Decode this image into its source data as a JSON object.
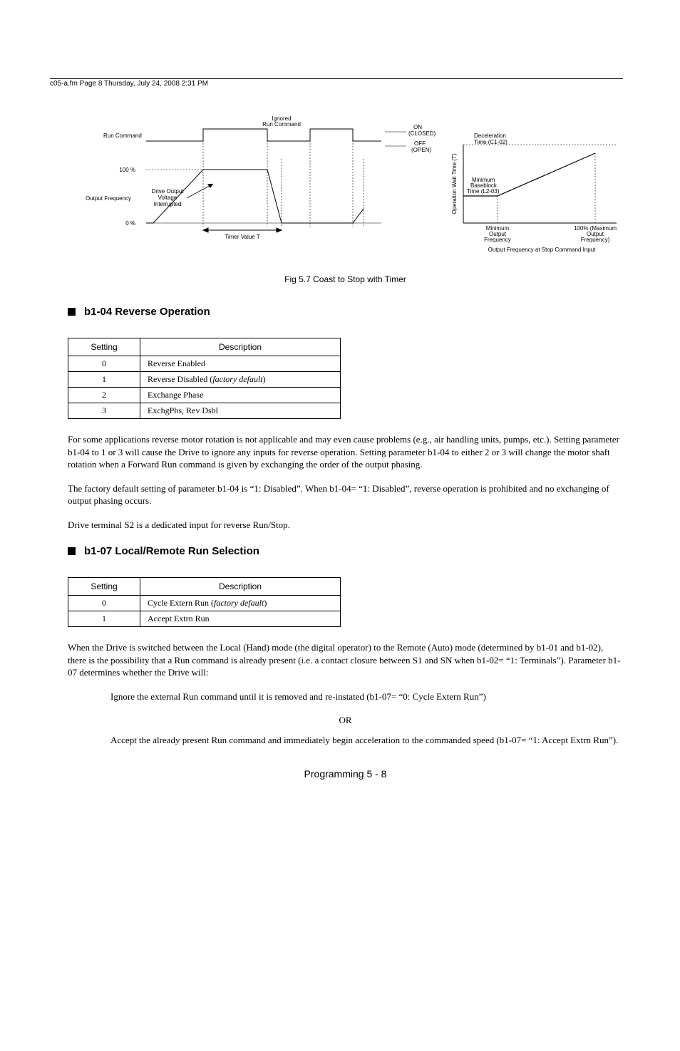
{
  "header_note": "c05-a.fm  Page 8  Thursday, July 24, 2008  2:31 PM",
  "figure": {
    "labels": {
      "ignored": "Ignored",
      "run_cmd_top": "Run Command",
      "run_command": "Run Command",
      "output_freq": "Output Frequency",
      "drive_out1": "Drive Output",
      "drive_out2": "Voltage",
      "drive_out3": "Interrupted",
      "p100": "100 %",
      "p0": "0 %",
      "timer": "Timer Value T",
      "on": "ON",
      "closed": "(CLOSED)",
      "off": "OFF",
      "open": "(OPEN)",
      "decel1": "Deceleration",
      "decel2": "Time (C1-02)",
      "yaxis": "Operation Wait Time (T)",
      "min1": "Minimum",
      "min2": "Baseblock",
      "min3": "Time (L2-03)",
      "xmin1": "Minimum",
      "xmin2": "Output",
      "xmin3": "Frequency",
      "xmax1": "100% (Maximum",
      "xmax2": "Output",
      "xmax3": "Frequency)",
      "xaxis": "Output Frequency at Stop Command Input"
    },
    "caption": "Fig 5.7  Coast to Stop with Timer"
  },
  "section1": {
    "title": "b1-04  Reverse Operation",
    "th_setting": "Setting",
    "th_desc": "Description",
    "rows": [
      {
        "s": "0",
        "d": "Reverse Enabled"
      },
      {
        "s": "1",
        "d_pre": "Reverse Disabled (",
        "d_it": "factory default",
        "d_post": ")"
      },
      {
        "s": "2",
        "d": "Exchange Phase"
      },
      {
        "s": "3",
        "d": "ExchgPhs, Rev Dsbl"
      }
    ],
    "p1": "For some applications reverse motor rotation is not applicable and may even cause problems (e.g., air handling units, pumps, etc.). Setting parameter b1-04 to 1 or 3 will cause the Drive to ignore any inputs for reverse operation. Setting parameter b1-04 to either 2 or 3 will change the motor shaft rotation when a Forward Run command is given by exchanging the order of the output phasing.",
    "p2": "The factory default setting of parameter b1-04 is “1: Disabled”. When b1-04= “1: Disabled”, reverse operation is prohibited and no exchanging of output phasing occurs.",
    "p3": "Drive terminal S2 is a dedicated input for reverse Run/Stop."
  },
  "section2": {
    "title": "b1-07  Local/Remote Run Selection",
    "th_setting": "Setting",
    "th_desc": "Description",
    "rows": [
      {
        "s": "0",
        "d_pre": "Cycle Extern Run (",
        "d_it": "factory default",
        "d_post": ")"
      },
      {
        "s": "1",
        "d": "Accept Extrn Run"
      }
    ],
    "p1": "When the Drive is switched between the Local (Hand) mode (the digital operator) to the Remote (Auto) mode (determined by b1-01 and b1-02), there is the possibility that a Run command is already present (i.e. a contact closure between S1 and SN when b1-02= “1: Terminals”). Parameter b1-07 determines whether the Drive will:",
    "line1": "Ignore the external Run command until it is removed and re-instated (b1-07= “0: Cycle Extern Run”)",
    "or": "OR",
    "line2": "Accept the already present Run command and immediately begin acceleration to the commanded speed (b1-07= “1: Accept Extrn Run”)."
  },
  "footer": "Programming  5 - 8"
}
